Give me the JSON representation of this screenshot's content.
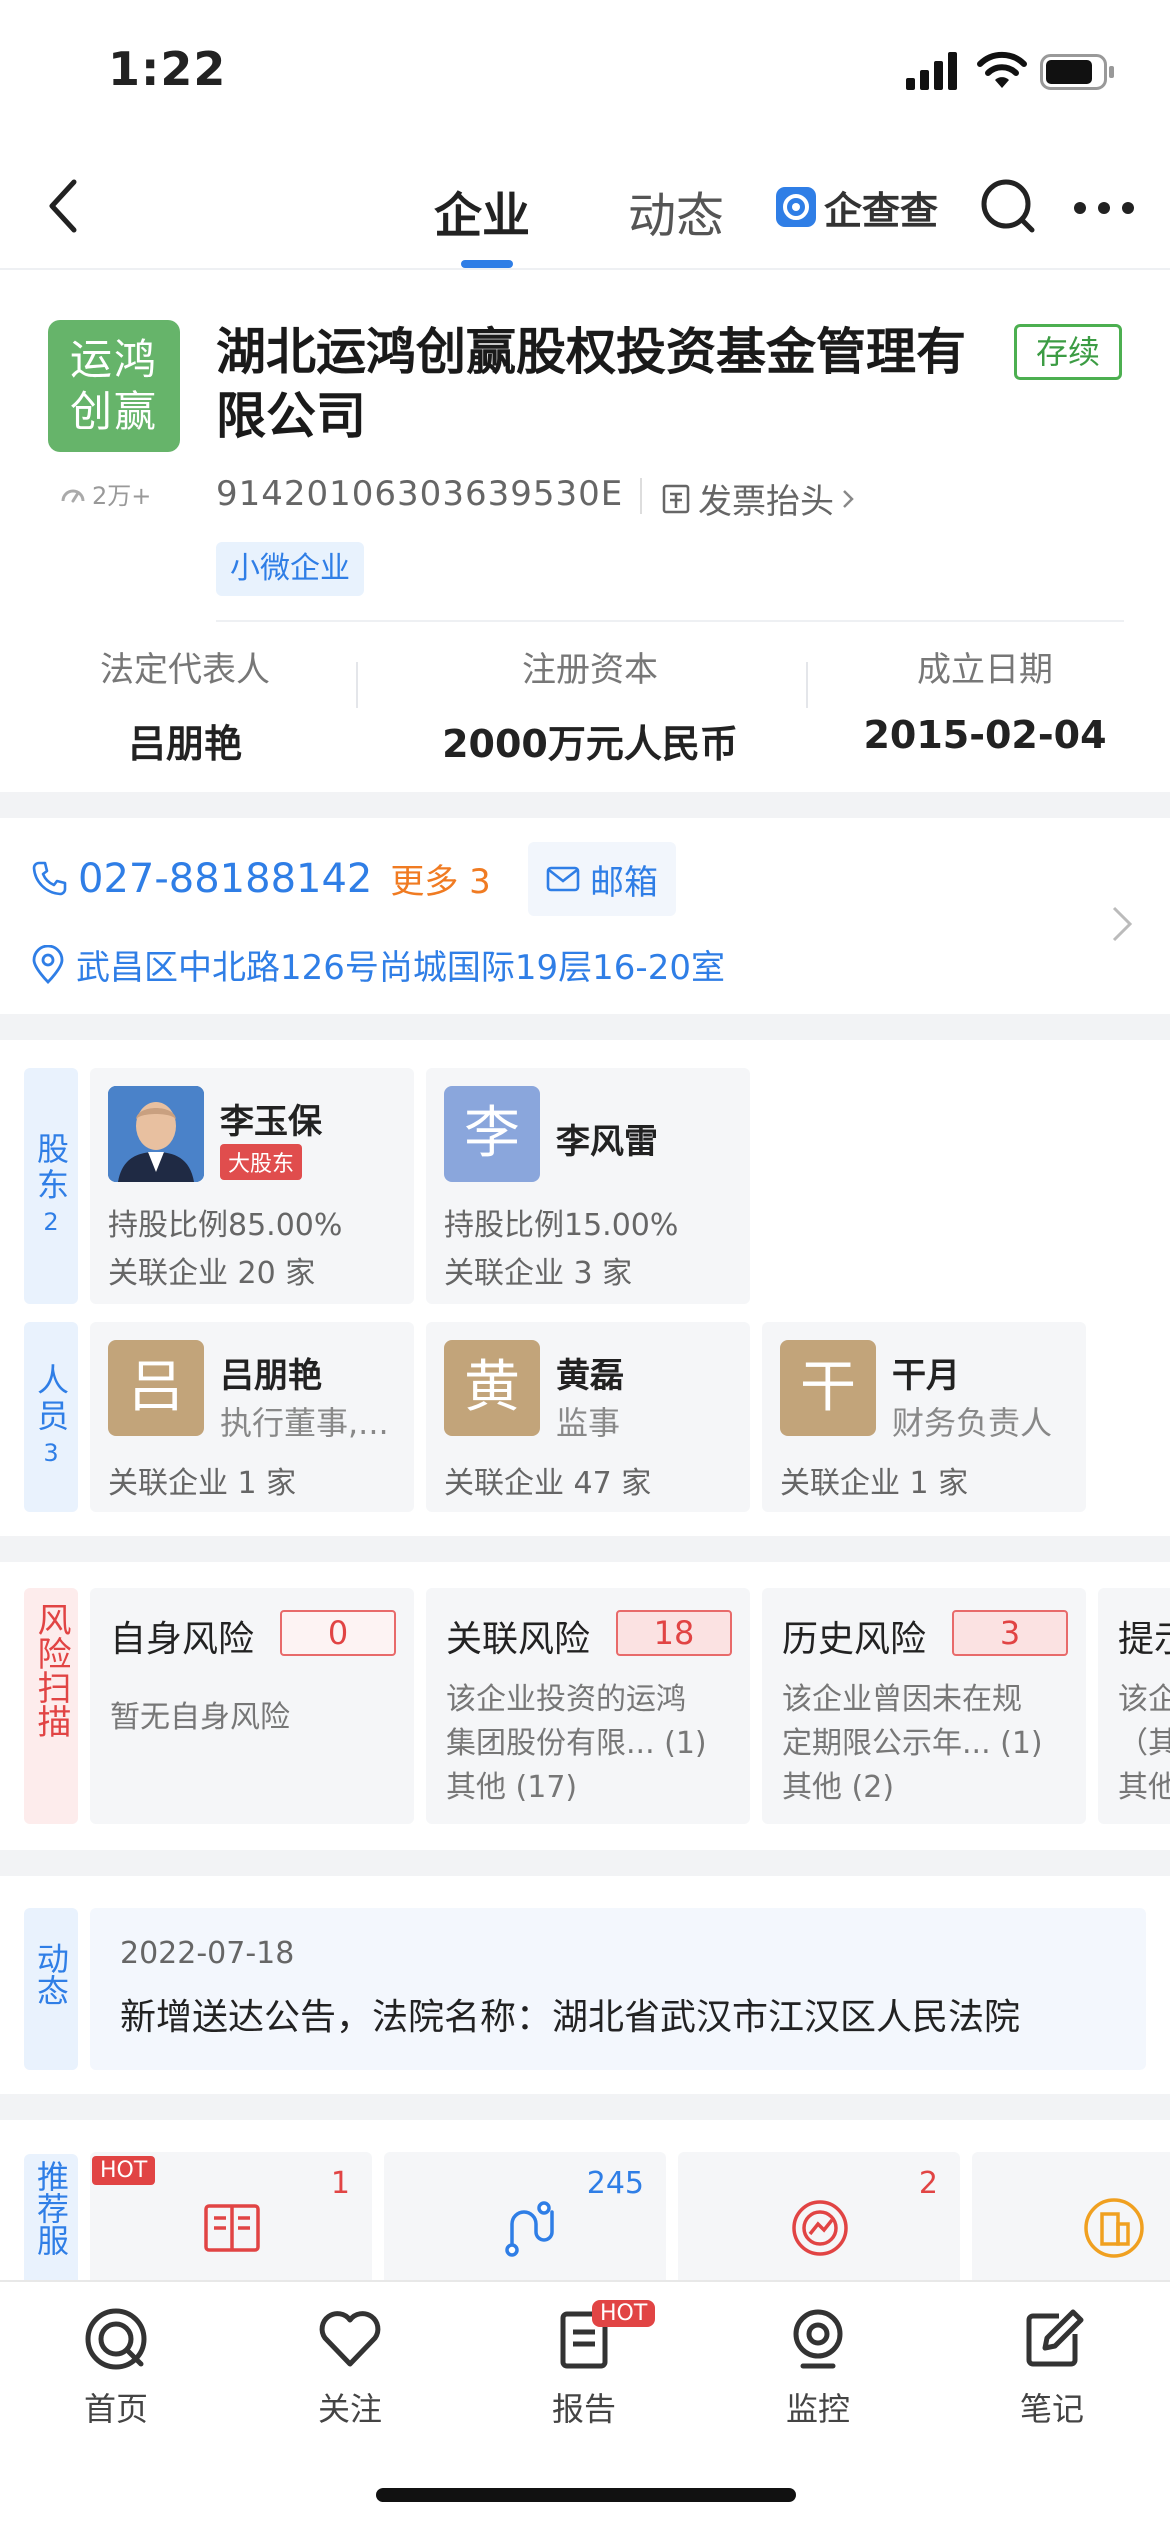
{
  "status_bar": {
    "time": "1:22"
  },
  "nav": {
    "tabs": [
      {
        "label": "企业",
        "active": true
      },
      {
        "label": "动态",
        "active": false
      }
    ],
    "brand": "企查查"
  },
  "company": {
    "logo_text": [
      "运鸿",
      "创赢"
    ],
    "followers": "2万+",
    "name": "湖北运鸿创赢股权投资基金管理有限公司",
    "status": "存续",
    "credit_code": "91420106303639530E",
    "invoice_link": "发票抬头",
    "size_tag": "小微企业",
    "legal_rep_label": "法定代表人",
    "legal_rep": "吕朋艳",
    "capital_label": "注册资本",
    "capital": "2000万元人民币",
    "founded_label": "成立日期",
    "founded": "2015-02-04"
  },
  "contact": {
    "phone": "027-88188142",
    "more": "更多 3",
    "email_label": "邮箱",
    "address": "武昌区中北路126号尚城国际19层16-20室"
  },
  "shareholders": {
    "label": "股东",
    "count": "2",
    "items": [
      {
        "avatar_text": "",
        "name": "李玉保",
        "badge": "大股东",
        "ratio": "持股比例85.00%",
        "related": "关联企业 20 家"
      },
      {
        "avatar_text": "李",
        "name": "李风雷",
        "ratio": "持股比例15.00%",
        "related": "关联企业 3 家"
      }
    ]
  },
  "staff": {
    "label": "人员",
    "count": "3",
    "items": [
      {
        "avatar_text": "吕",
        "name": "吕朋艳",
        "role": "执行董事,...",
        "related": "关联企业 1 家"
      },
      {
        "avatar_text": "黄",
        "name": "黄磊",
        "role": "监事",
        "related": "关联企业 47 家"
      },
      {
        "avatar_text": "干",
        "name": "干月",
        "role": "财务负责人",
        "related": "关联企业 1 家"
      }
    ]
  },
  "risk": {
    "label": "风险扫描",
    "items": [
      {
        "title": "自身风险",
        "count": "0",
        "lines": [
          "暂无自身风险"
        ]
      },
      {
        "title": "关联风险",
        "count": "18",
        "lines": [
          "该企业投资的运鸿",
          "集团股份有限... (1)",
          "其他 (17)"
        ]
      },
      {
        "title": "历史风险",
        "count": "3",
        "lines": [
          "该企业曾因未在规",
          "定期限公示年... (1)",
          "其他 (2)"
        ]
      },
      {
        "title": "提示",
        "count": "",
        "lines": [
          "该企",
          "（其",
          "其他"
        ]
      }
    ]
  },
  "dynamic": {
    "label": "动态",
    "date": "2022-07-18",
    "text": "新增送达公告，法院名称：湖北省武汉市江汉区人民法院"
  },
  "recommend": {
    "label": "推荐服",
    "items": [
      {
        "icon": "book-icon",
        "count": "1",
        "hot": "HOT",
        "color": "#e14444"
      },
      {
        "icon": "route-icon",
        "count": "245",
        "hot": "",
        "color": "#2f7ee6"
      },
      {
        "icon": "monitor-chart-icon",
        "count": "2",
        "hot": "",
        "color": "#e14444"
      },
      {
        "icon": "building-icon",
        "count": "",
        "hot": "",
        "color": "#f0a020"
      }
    ]
  },
  "tabbar": {
    "items": [
      {
        "label": "首页",
        "icon": "home-q-icon"
      },
      {
        "label": "关注",
        "icon": "heart-icon"
      },
      {
        "label": "报告",
        "icon": "report-icon",
        "hot": "HOT"
      },
      {
        "label": "监控",
        "icon": "camera-icon"
      },
      {
        "label": "笔记",
        "icon": "note-icon"
      }
    ]
  }
}
